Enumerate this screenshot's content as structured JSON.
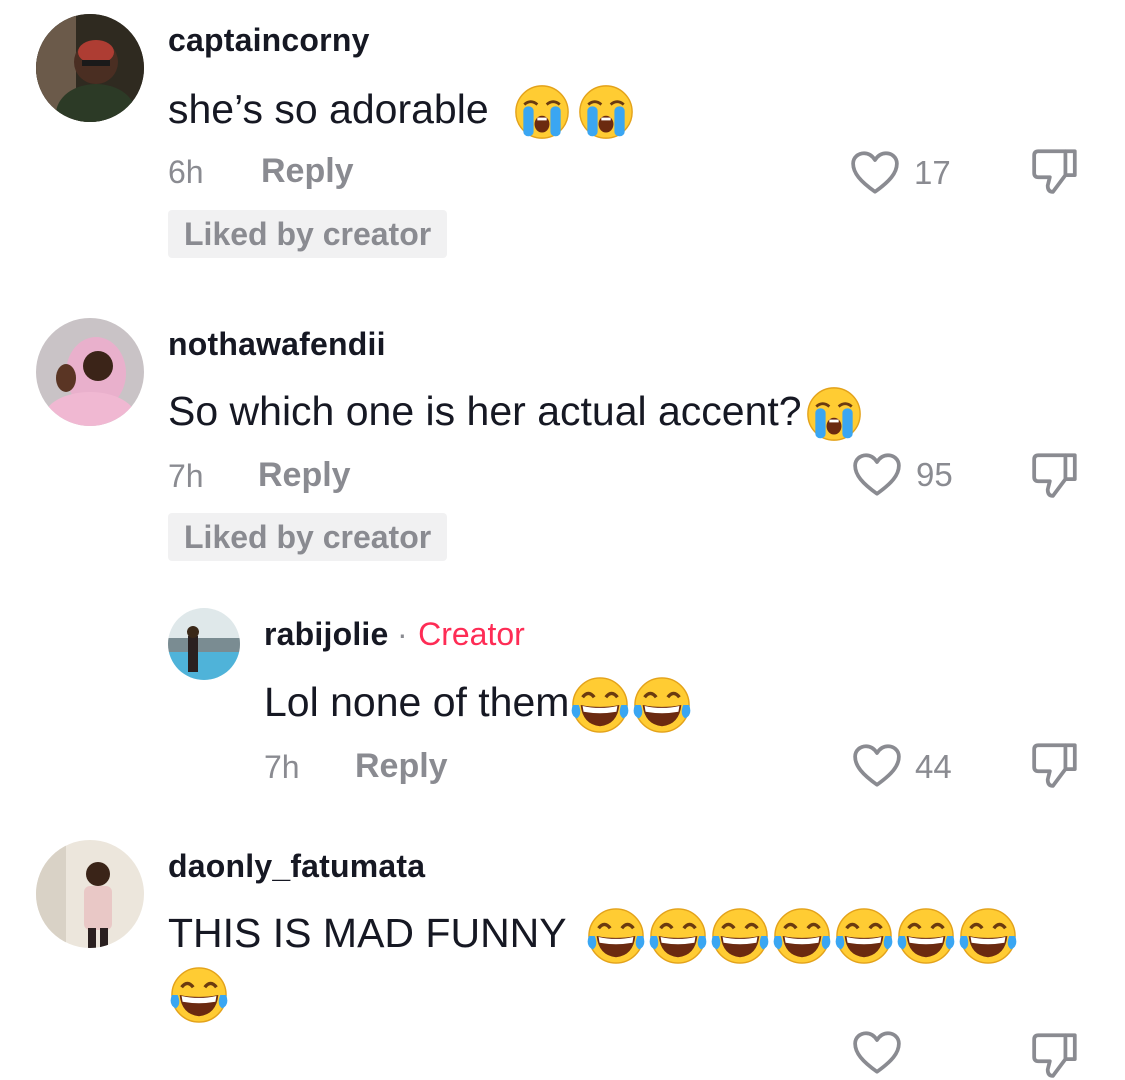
{
  "comments": [
    {
      "username": "captaincorny",
      "text": "she’s so adorable",
      "emojis": [
        "loudly-crying-face",
        "loudly-crying-face"
      ],
      "time": "6h",
      "reply_label": "Reply",
      "likes": "17",
      "badge": "Liked by creator",
      "avatar": "avatar-captaincorny"
    },
    {
      "username": "nothawafendii",
      "text": "So which one is her actual accent?",
      "emojis": [
        "loudly-crying-face"
      ],
      "time": "7h",
      "reply_label": "Reply",
      "likes": "95",
      "badge": "Liked by creator",
      "avatar": "avatar-nothawafendii"
    },
    {
      "username": "rabijolie",
      "separator": "·",
      "creator_label": "Creator",
      "text": "Lol none of them",
      "emojis": [
        "face-with-tears-of-joy",
        "face-with-tears-of-joy"
      ],
      "time": "7h",
      "reply_label": "Reply",
      "likes": "44",
      "avatar": "avatar-rabijolie"
    },
    {
      "username": "daonly_fatumata",
      "text": "THIS IS MAD FUNNY",
      "emojis": [
        "face-with-tears-of-joy",
        "face-with-tears-of-joy",
        "face-with-tears-of-joy",
        "face-with-tears-of-joy",
        "face-with-tears-of-joy",
        "face-with-tears-of-joy",
        "face-with-tears-of-joy",
        "face-with-tears-of-joy"
      ],
      "avatar": "avatar-daonly-fatumata"
    }
  ],
  "icons": {
    "like": "heart-outline-icon",
    "dislike": "thumbs-down-icon"
  },
  "colors": {
    "text": "#161823",
    "muted": "#8a8b91",
    "creator": "#fe2c55",
    "badge_bg": "#f1f1f2"
  }
}
